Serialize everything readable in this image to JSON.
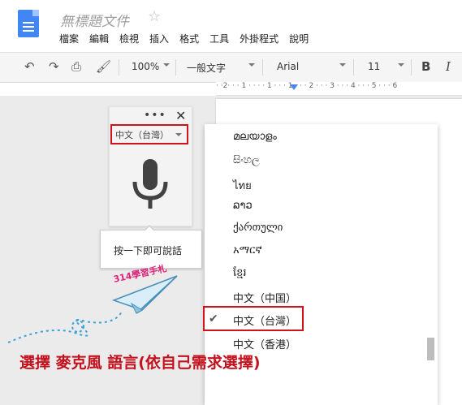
{
  "doc": {
    "title": "無標題文件"
  },
  "menu": [
    "檔案",
    "編輯",
    "檢視",
    "插入",
    "格式",
    "工具",
    "外掛程式",
    "說明"
  ],
  "toolbar": {
    "zoom": "100%",
    "style": "一般文字",
    "font": "Arial",
    "size": "11",
    "bold": "B",
    "italic": "I"
  },
  "ruler": {
    "marks": "· ·2· · · 1 · · · · 1 · · · 1 · · · 2 · · · 3 · · · 4 · · · 5 · · · 6"
  },
  "voice": {
    "more": "•••",
    "close": "✕",
    "selected_language": "中文（台灣）",
    "tooltip": "按一下即可說話"
  },
  "languages": [
    "മലയാളം",
    "සිංහල",
    "ไทย",
    "ລາວ",
    "ქართული",
    "አማርኛ",
    "ខ្មែរ",
    "中文（中国）",
    "中文（台灣）",
    "中文（香港）"
  ],
  "selected_language": "中文（台灣）",
  "logo_text": "314學習手札",
  "caption": "選擇 麥克風 語言(依自己需求選擇)",
  "colors": {
    "highlight": "#d0121b",
    "accent": "#4285f4",
    "caption": "#c3111d",
    "logo": "#e0237a"
  }
}
